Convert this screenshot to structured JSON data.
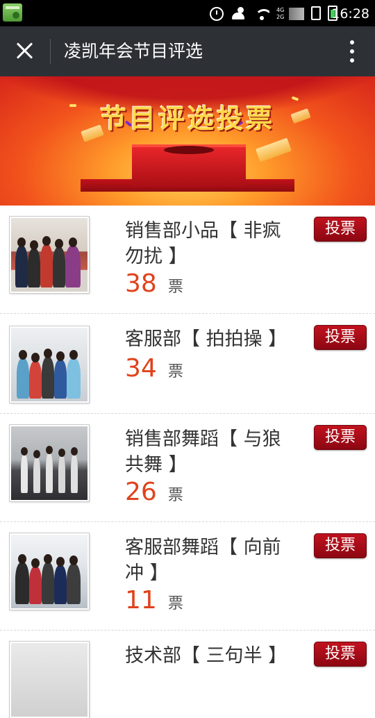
{
  "status_bar": {
    "time": "16:28",
    "net_top": "4G",
    "net_bottom": "2G",
    "icons": [
      "app-icon",
      "alarm-icon",
      "contacts-icon",
      "wifi-icon",
      "signal-icon",
      "sim-icon",
      "battery-icon"
    ]
  },
  "app_bar": {
    "title": "凌凯年会节目评选",
    "close_icon": "close-icon",
    "more_icon": "more-vertical-icon"
  },
  "banner": {
    "title": "节目评选投票"
  },
  "programs": [
    {
      "name": "销售部小品【 非疯勿扰 】",
      "votes": "38",
      "unit": "票",
      "button": "投票"
    },
    {
      "name": "客服部【 拍拍操 】",
      "votes": "34",
      "unit": "票",
      "button": "投票"
    },
    {
      "name": "销售部舞蹈【 与狼共舞 】",
      "votes": "26",
      "unit": "票",
      "button": "投票"
    },
    {
      "name": "客服部舞蹈【 向前冲 】",
      "votes": "11",
      "unit": "票",
      "button": "投票"
    },
    {
      "name": "技术部【 三句半 】",
      "votes": "",
      "unit": "",
      "button": "投票"
    }
  ],
  "colors": {
    "app_bar": "#2d3136",
    "vote_count": "#e0421c",
    "vote_button": "#a80e18"
  }
}
